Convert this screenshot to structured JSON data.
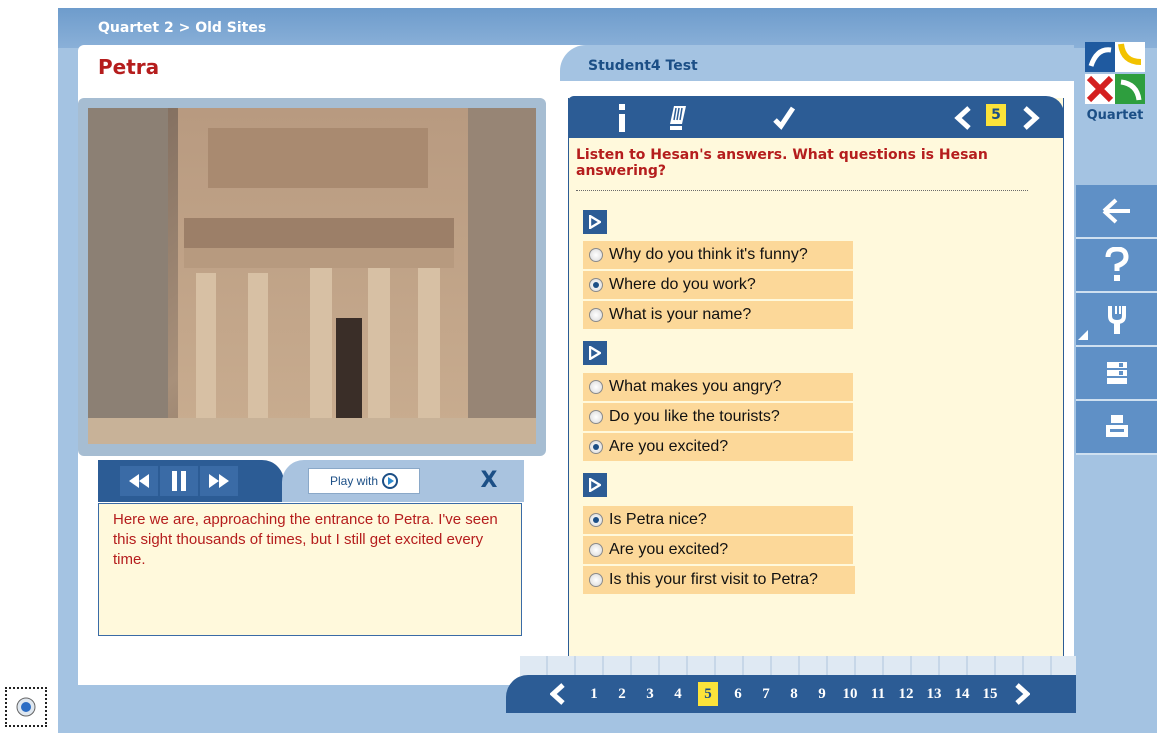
{
  "header": {
    "breadcrumb": "Quartet 2 > Old Sites",
    "title": "Petra",
    "student": "Student4 Test"
  },
  "logo": {
    "text": "Quartet"
  },
  "video": {
    "play_with_label": "Play with",
    "close_label": "X",
    "transcript": "Here we are, approaching the entrance to Petra. I've seen this sight thousands of times, but I still get excited every time."
  },
  "exercise": {
    "toolbar_icons": [
      "info-icon",
      "eraser-icon",
      "check-icon",
      "prev-arrow-icon",
      "next-arrow-icon"
    ],
    "page_number": "5",
    "instruction": "Listen to Hesan's answers. What questions is Hesan answering?",
    "groups": [
      {
        "options": [
          {
            "label": "Why do you think it's funny?",
            "checked": false
          },
          {
            "label": "Where do you work?",
            "checked": true
          },
          {
            "label": "What is your name?",
            "checked": false
          }
        ]
      },
      {
        "options": [
          {
            "label": "What makes you angry?",
            "checked": false
          },
          {
            "label": "Do you like the tourists?",
            "checked": false
          },
          {
            "label": "Are you excited?",
            "checked": true
          }
        ]
      },
      {
        "options": [
          {
            "label": "Is Petra nice?",
            "checked": true
          },
          {
            "label": "Are you excited?",
            "checked": false
          },
          {
            "label": "Is this your first visit to Petra?",
            "checked": false
          }
        ]
      }
    ]
  },
  "sidebar": {
    "buttons": [
      "back-arrow-icon",
      "help-icon",
      "tools-icon",
      "stack-icon",
      "print-icon"
    ]
  },
  "pager": {
    "pages": [
      "1",
      "2",
      "3",
      "4",
      "5",
      "6",
      "7",
      "8",
      "9",
      "10",
      "11",
      "12",
      "13",
      "14",
      "15"
    ],
    "current": "5"
  },
  "colors": {
    "frame": "#a4c3e2",
    "dark_blue": "#2c5c95",
    "title_red": "#b51d1d",
    "option_bg": "#fcd899",
    "panel_bg": "#fff9dc",
    "highlight": "#fce33a"
  }
}
